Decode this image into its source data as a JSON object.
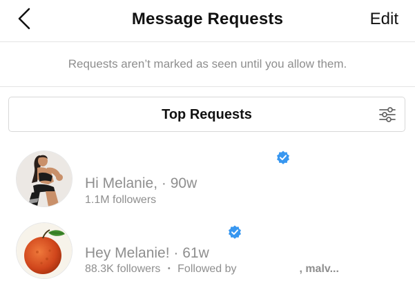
{
  "header": {
    "title": "Message Requests",
    "edit_label": "Edit"
  },
  "notice": {
    "text": "Requests aren’t marked as seen until you allow them."
  },
  "filter": {
    "label": "Top Requests",
    "icon": "sliders-icon"
  },
  "requests": [
    {
      "message": "Hi Melanie,",
      "separator": "·",
      "time": "90w",
      "followers": "1.1M followers",
      "verified": true
    },
    {
      "message": "Hey Melanie!",
      "separator": "·",
      "time": "61w",
      "followers": "88.3K followers",
      "dot": "•",
      "followed_by": "Followed by",
      "followed_by_names": ", malv...",
      "verified": true
    }
  ],
  "colors": {
    "verified_blue": "#3897f0",
    "secondary_text": "#8e8e8e",
    "divider": "#e3e3e3"
  }
}
